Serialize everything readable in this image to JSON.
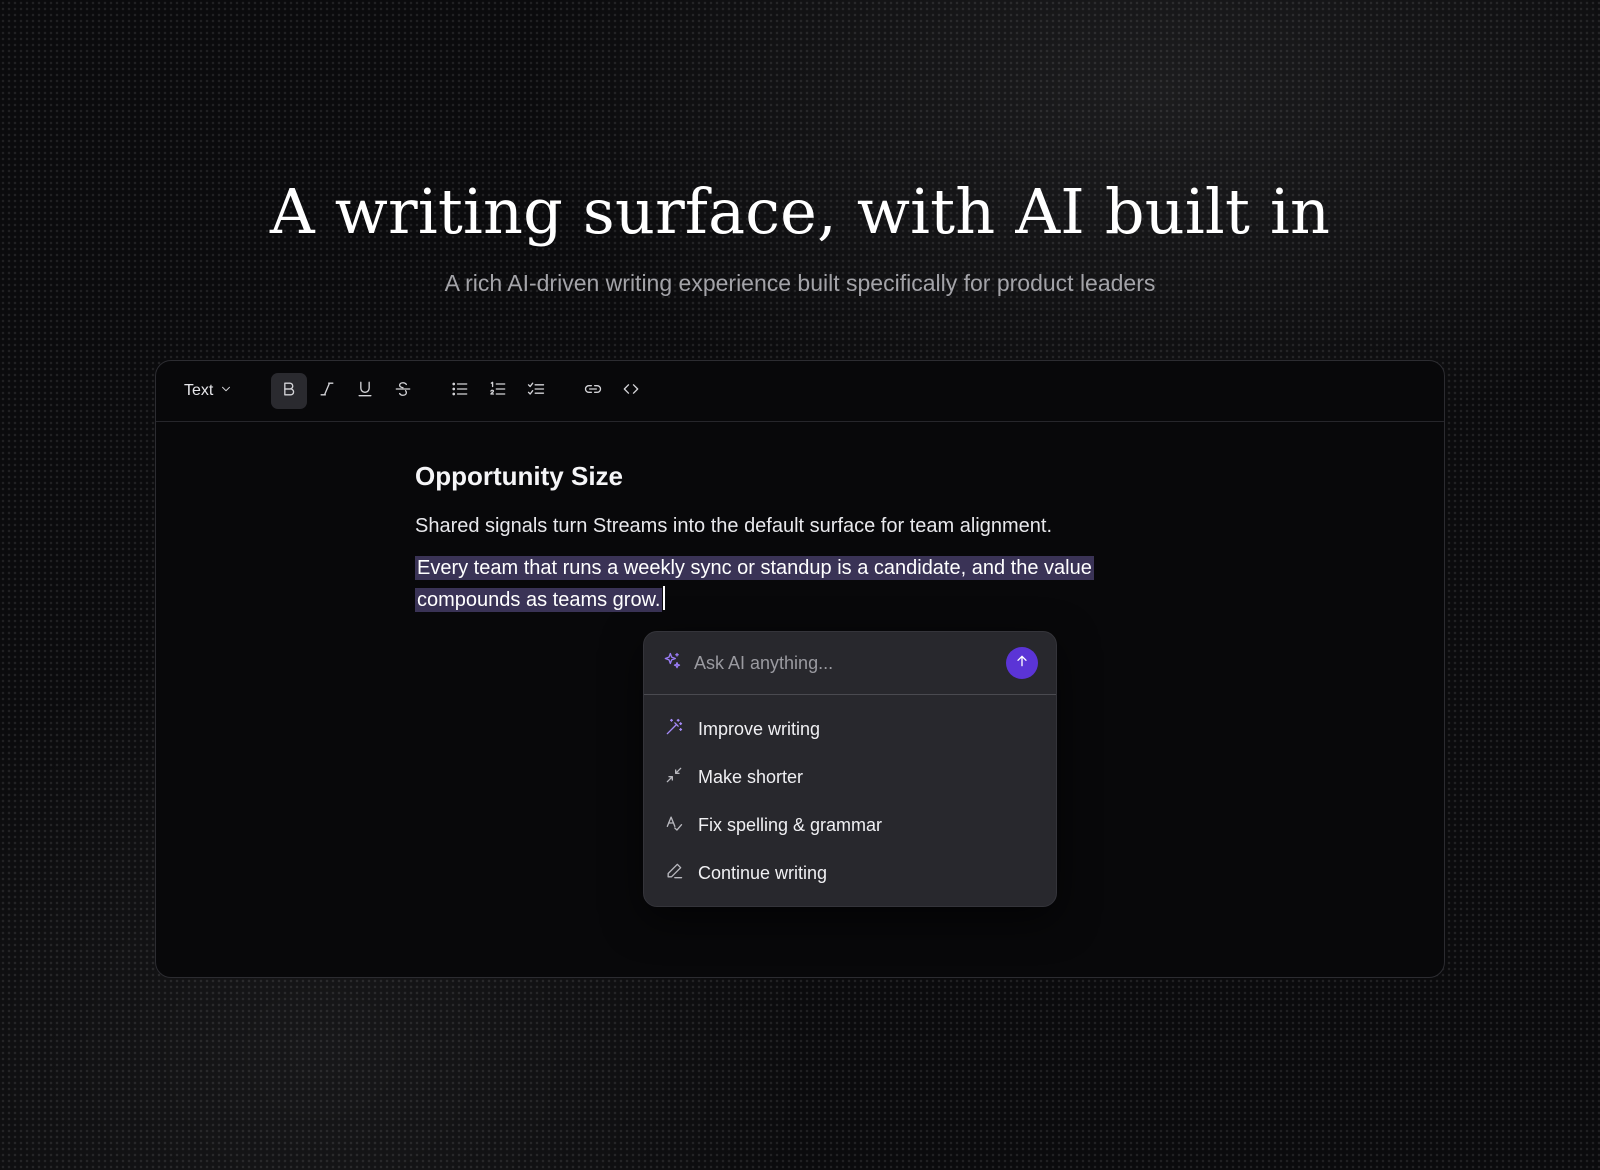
{
  "hero": {
    "title": "A writing surface, with AI built in",
    "subtitle": "A rich AI-driven writing experience built specifically for product leaders"
  },
  "toolbar": {
    "text_style_label": "Text",
    "buttons": [
      "bold-icon",
      "italic-icon",
      "underline-icon",
      "strikethrough-icon",
      "bullet-list-icon",
      "numbered-list-icon",
      "checklist-icon",
      "link-icon",
      "code-icon"
    ],
    "active_button": "bold-icon"
  },
  "document": {
    "heading": "Opportunity Size",
    "paragraph_1": "Shared signals turn Streams into the default surface for team alignment.",
    "paragraph_2": "Every team that runs a weekly sync or standup is a candidate, and the value compounds as teams grow."
  },
  "ai_popup": {
    "placeholder": "Ask AI anything...",
    "items": [
      {
        "label": "Improve writing",
        "icon": "magic-wand-icon"
      },
      {
        "label": "Make shorter",
        "icon": "minimize-arrows-icon"
      },
      {
        "label": "Fix spelling & grammar",
        "icon": "spell-check-icon"
      },
      {
        "label": "Continue writing",
        "icon": "pencil-icon"
      }
    ],
    "accent_color": "#5b34d6"
  }
}
